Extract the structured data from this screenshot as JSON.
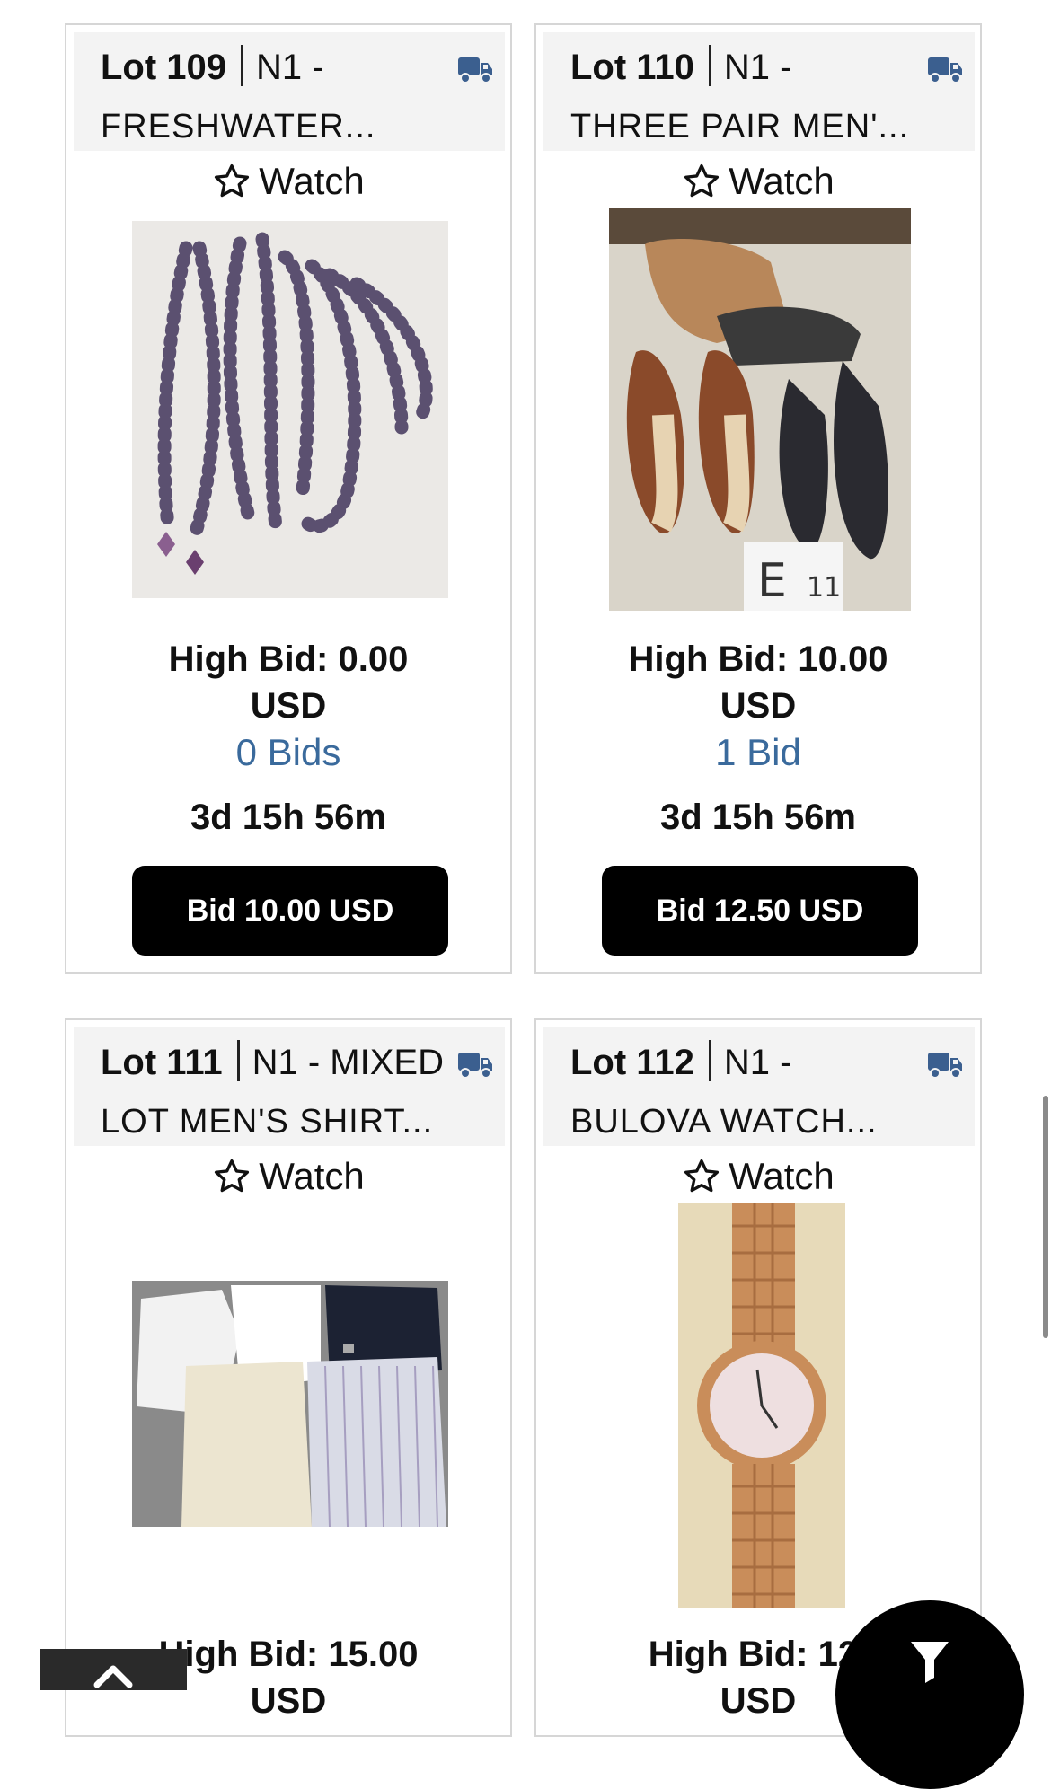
{
  "watch_label": "Watch",
  "lots": [
    {
      "number": "Lot 109",
      "title_line1": "N1 -",
      "title_line2": "FRESHWATER...",
      "high_bid": "High Bid: 0.00",
      "currency": "USD",
      "bids": "0 Bids",
      "time_left": "3d 15h 56m",
      "bid_button": "Bid 10.00 USD"
    },
    {
      "number": "Lot 110",
      "title_line1": "N1 -",
      "title_line2": "THREE PAIR MEN'...",
      "high_bid": "High Bid: 10.00",
      "currency": "USD",
      "bids": "1 Bid",
      "time_left": "3d 15h 56m",
      "bid_button": "Bid 12.50 USD"
    },
    {
      "number": "Lot 111",
      "title_line1": "N1 - MIXED",
      "title_line2": "LOT MEN'S SHIRT...",
      "high_bid": "High Bid: 15.00",
      "currency": "USD"
    },
    {
      "number": "Lot 112",
      "title_line1": "N1 -",
      "title_line2": "BULOVA WATCH...",
      "high_bid": "High Bid: 12.",
      "currency": "USD"
    }
  ],
  "icons": {
    "shipping": "truck-icon",
    "watch": "star-outline-icon",
    "scroll_top": "chevron-up-icon",
    "filter": "filter-icon"
  },
  "colors": {
    "bid_count": "#3a6a9c",
    "truck": "#3b5f8f",
    "button_bg": "#000000"
  }
}
